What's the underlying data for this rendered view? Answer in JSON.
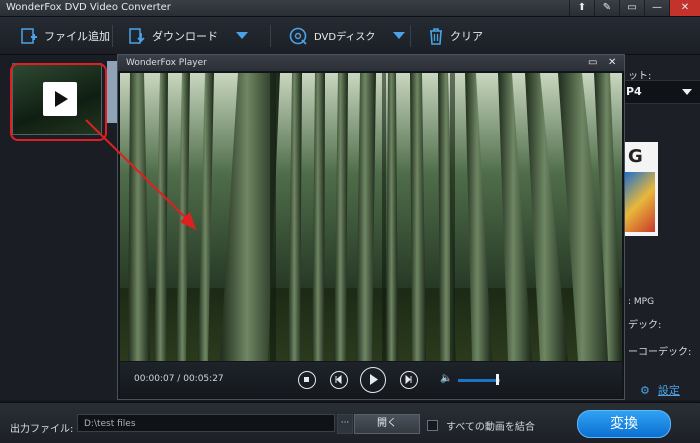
{
  "window": {
    "title": "WonderFox DVD Video Converter"
  },
  "toolbar": {
    "add_files": "ファイル追加",
    "download": "ダウンロード",
    "dvd_disc": "DVDディスク",
    "clear": "クリア"
  },
  "right_panel": {
    "output_format_label": "ット:",
    "output_format_value": "P4",
    "format_icon_text": "G",
    "info_format": ": MPG",
    "info_codec": "デック:",
    "info_audio_codec": "ーコーデック:",
    "settings_label": "設定"
  },
  "player": {
    "title": "WonderFox Player",
    "current_time": "00:00:07",
    "duration": "00:05:27",
    "time_separator": "/",
    "volume_level": 0.9
  },
  "bottom": {
    "output_label": "出力ファイル:",
    "output_path": "D:\\test files",
    "browse": "···",
    "open": "開く",
    "merge_all": "すべての動画を結合",
    "convert": "変換"
  },
  "colors": {
    "accent": "#1b8ae6",
    "highlight": "#e02020"
  }
}
